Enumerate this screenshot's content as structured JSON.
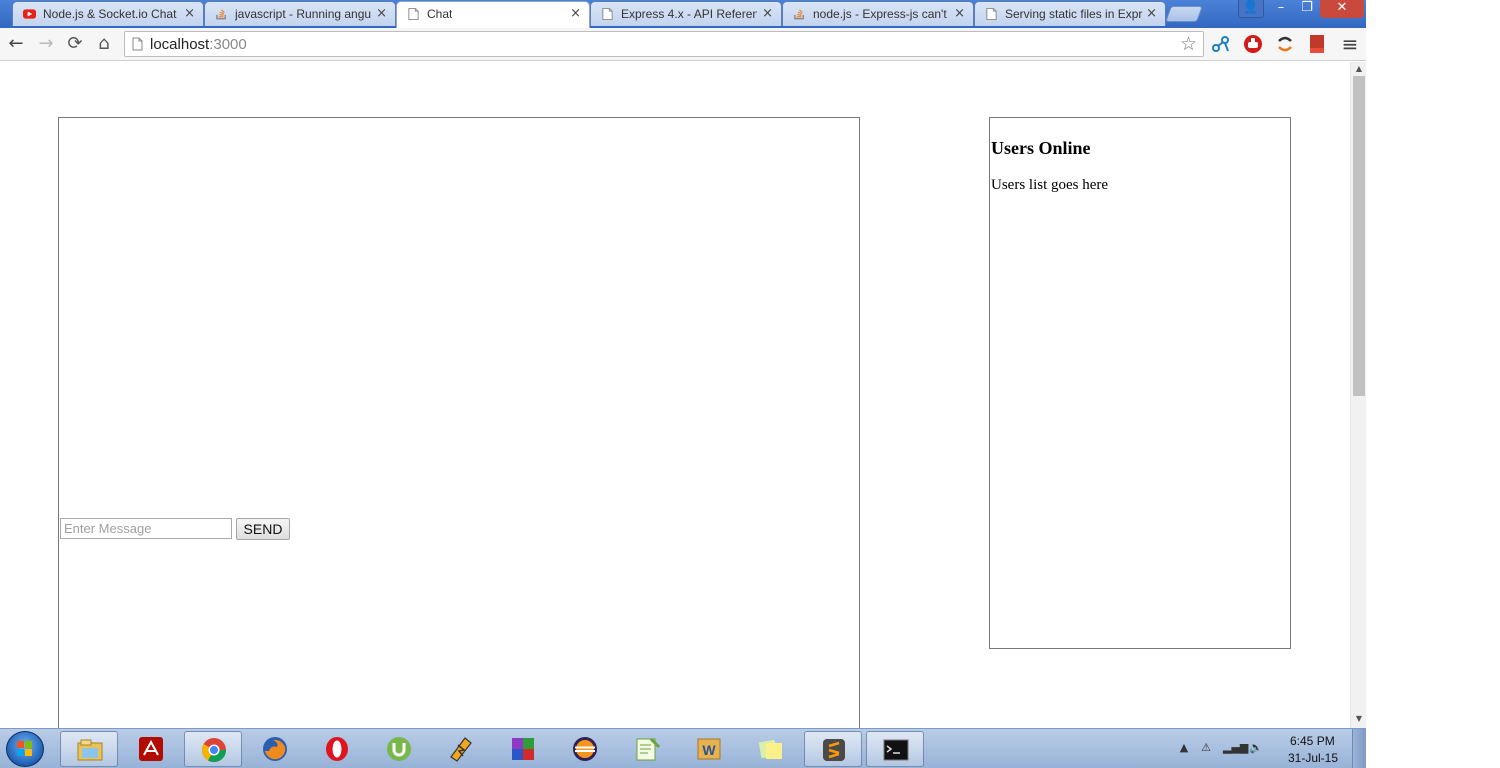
{
  "browser": {
    "tabs": [
      {
        "title": "Node.js & Socket.io Chat",
        "close": "×",
        "icon": "youtube-icon"
      },
      {
        "title": "javascript - Running angu",
        "close": "×",
        "icon": "stackoverflow-icon"
      },
      {
        "title": "Chat",
        "close": "×",
        "icon": "page-icon",
        "active": true
      },
      {
        "title": "Express 4.x - API Referenc",
        "close": "×",
        "icon": "page-icon"
      },
      {
        "title": "node.js - Express-js can't",
        "close": "×",
        "icon": "stackoverflow-icon"
      },
      {
        "title": "Serving static files in Expr",
        "close": "×",
        "icon": "page-icon"
      }
    ],
    "window_controls": {
      "user": "👤",
      "minimize": "–",
      "restore": "❐",
      "close": "✕"
    },
    "nav": {
      "back": "←",
      "forward": "→",
      "reload": "⟳",
      "home": "⌂"
    },
    "omnibox": {
      "host": "localhost",
      "port": ":3000",
      "star": "☆"
    },
    "menu": "≡"
  },
  "page": {
    "message_placeholder": "Enter Message",
    "send_label": "SEND",
    "users_title": "Users Online",
    "users_list_text": "Users list goes here"
  },
  "taskbar": {
    "clock_time": "6:45 PM",
    "clock_date": "31-Jul-15",
    "apps": [
      "explorer-icon",
      "acrobat-icon",
      "chrome-icon",
      "firefox-icon",
      "opera-icon",
      "utorrent-icon",
      "winamp-icon",
      "winrar-icon",
      "eclipse-icon",
      "notepadpp-icon",
      "word-icon",
      "sticky-notes-icon",
      "sublime-icon",
      "cmd-icon"
    ]
  }
}
